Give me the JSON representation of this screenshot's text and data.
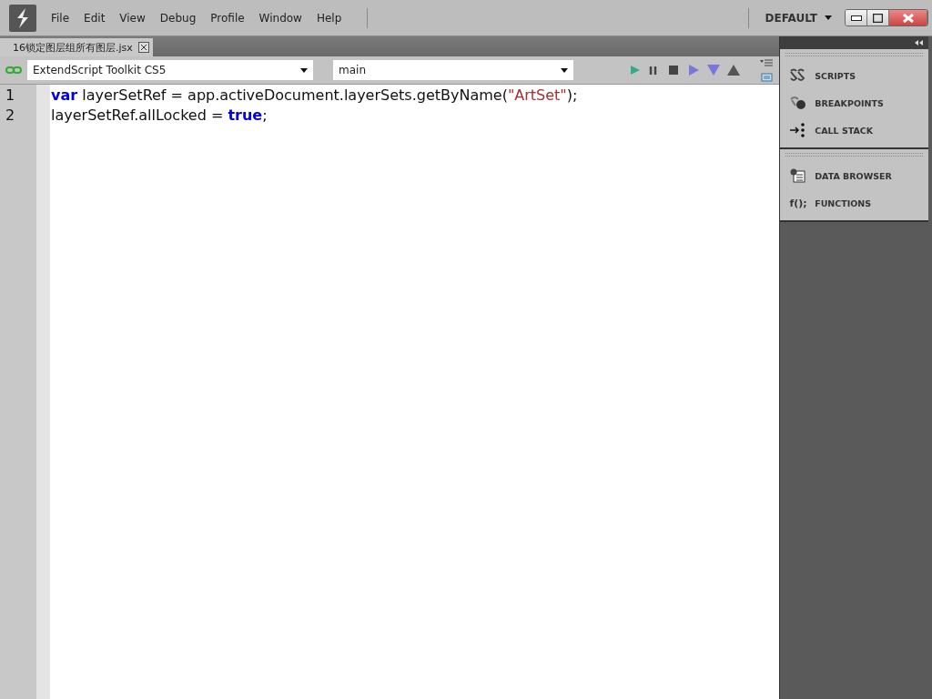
{
  "menu": [
    "File",
    "Edit",
    "View",
    "Debug",
    "Profile",
    "Window",
    "Help"
  ],
  "workspace": "DEFAULT",
  "tab": {
    "label": "16锁定图层组所有图层.jsx",
    "selected": true
  },
  "target": {
    "value": "ExtendScript Toolkit CS5"
  },
  "engine": {
    "value": "main"
  },
  "code": [
    {
      "number": "1",
      "tokens": [
        {
          "kind": "keyword",
          "text": "var"
        },
        {
          "kind": "plain",
          "text": " layerSetRef = app.activeDocument.layerSets.getByName("
        },
        {
          "kind": "string",
          "text": "\"ArtSet\""
        },
        {
          "kind": "plain",
          "text": ");"
        }
      ]
    },
    {
      "number": "2",
      "tokens": [
        {
          "kind": "plain",
          "text": "layerSetRef.allLocked = "
        },
        {
          "kind": "keyword",
          "text": "true"
        },
        {
          "kind": "plain",
          "text": ";"
        }
      ]
    }
  ],
  "panel_groups": [
    [
      {
        "kind": "scripts",
        "label": "SCRIPTS"
      },
      {
        "kind": "breakpoints",
        "label": "BREAKPOINTS"
      },
      {
        "kind": "callstack",
        "label": "CALL STACK"
      }
    ],
    [
      {
        "kind": "data",
        "label": "DATA BROWSER"
      },
      {
        "kind": "functions",
        "label": "FUNCTIONS",
        "icon_text": "f();"
      }
    ]
  ]
}
